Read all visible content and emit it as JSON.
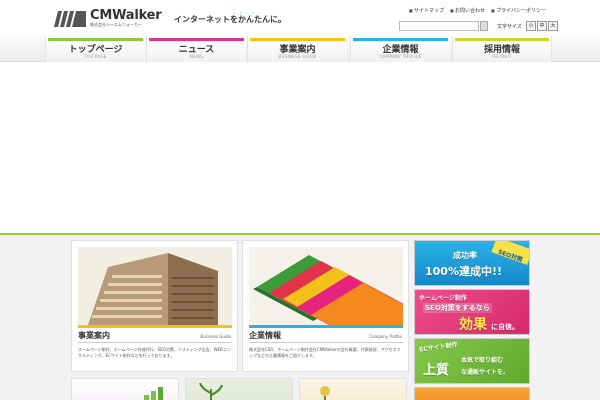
{
  "header": {
    "logo_text": "CMWalker",
    "logo_sub": "株式会社シーエムウォーカー",
    "tagline": "インターネットをかんたんに。",
    "tagline_dots": "・・・・",
    "links": [
      "サイトマップ",
      "お問い合わせ",
      "プライバシーポリシー"
    ],
    "search_placeholder": "",
    "fontsize_label": "文字サイズ",
    "fontsize_buttons": [
      "小",
      "中",
      "大"
    ]
  },
  "nav": [
    {
      "label": "トップページ",
      "sub": "TOP PAGE",
      "color": "#8dc63f"
    },
    {
      "label": "ニュース",
      "sub": "NEWS",
      "color": "#d6378a"
    },
    {
      "label": "事業案内",
      "sub": "BUSINESS GUIDE",
      "color": "#f2c21b"
    },
    {
      "label": "企業情報",
      "sub": "COMPANY PROFILE",
      "color": "#2bb3e0"
    },
    {
      "label": "採用情報",
      "sub": "RECRUIT",
      "color": "#c8d62a"
    }
  ],
  "cards": [
    {
      "title": "事業案内",
      "en": "Business Guide",
      "bar_color": "#f2c21b",
      "text": "ホームページ制作、ホームページ作成代行、SEO対策、リスティング広告、WEBコンサルティング、ECサイト制作などを行っております。"
    },
    {
      "title": "企業情報",
      "en": "Company Profile",
      "bar_color": "#2bb3e0",
      "text": "株式会社CSR、ホームページ制作会社CMWalkerの会社概要、代表挨拶、アクセスマップなどの企業情報をご紹介します。"
    }
  ],
  "banners": [
    {
      "line1": "成功率",
      "line2": "100%達成中!!",
      "badge": "SEO対策"
    },
    {
      "line1": "ホームページ制作",
      "line2": "SEO対策をするなら",
      "line3": "効果",
      "line4": "に自信。"
    },
    {
      "line1": "ECサイト制作",
      "line2": "上質",
      "line3": "本気で取り組む",
      "line4": "な通販サイトを。"
    }
  ],
  "colors": {
    "accent_green": "#99cc33",
    "banner_blue": "#1aa0d8",
    "banner_pink": "#e8337a",
    "banner_green": "#7cc242"
  }
}
